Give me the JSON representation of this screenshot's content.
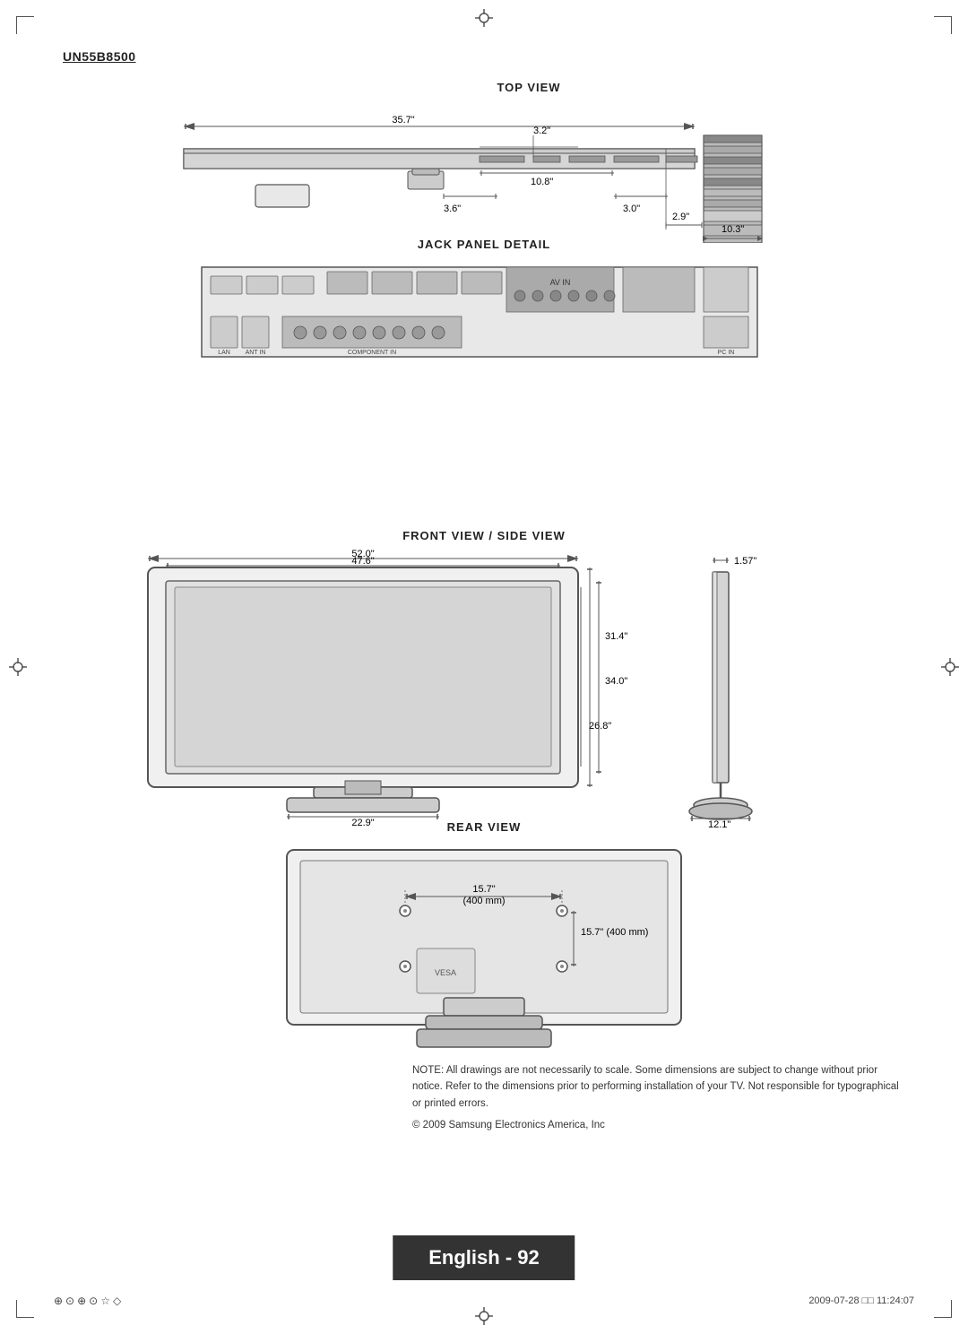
{
  "model": "UN55B8500",
  "sections": {
    "top_view": {
      "label": "TOP VIEW",
      "dimensions": {
        "d1": "10.3\"",
        "d2": "2.9\"",
        "d3": "3.2\"",
        "d4": "35.7\"",
        "d5": "10.8\"",
        "d6": "3.6\"",
        "d7": "3.0\""
      }
    },
    "jack_panel": {
      "label": "JACK PANEL DETAIL"
    },
    "front_side": {
      "label": "FRONT VIEW / SIDE VIEW",
      "dimensions": {
        "width_outer": "52.0\"",
        "width_inner": "47.6\"",
        "height_outer": "34.0\"",
        "height_inner": "31.4\"",
        "height_mid": "26.8\"",
        "base_width": "22.9\"",
        "depth": "1.57\"",
        "stand_width": "12.1\""
      }
    },
    "rear_view": {
      "label": "REAR VIEW",
      "dimensions": {
        "vesa_h": "15.7\"",
        "vesa_h_mm": "(400 mm)",
        "vesa_v": "15.7\" (400 mm)"
      }
    }
  },
  "note": {
    "text": "NOTE: All drawings are not necessarily to scale. Some dimensions are subject to change without prior notice. Refer to the dimensions prior to performing installation of your TV. Not responsible for typographical or printed errors.",
    "copyright": "© 2009 Samsung Electronics America, Inc"
  },
  "footer": {
    "english_label": "English - 92",
    "bottom_left_icons": "⊕⊙⊕⊙☆◇",
    "date_stamp": "2009-07-28  □□  11:24:07"
  }
}
